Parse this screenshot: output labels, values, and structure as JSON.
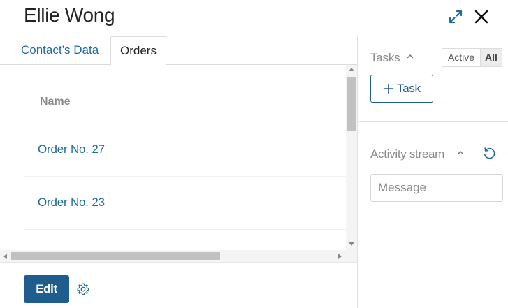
{
  "header": {
    "title": "Ellie Wong",
    "expand_icon": "expand-arrows-icon",
    "close_icon": "close-icon"
  },
  "tabs": [
    {
      "label": "Contact’s Data",
      "active": false
    },
    {
      "label": "Orders",
      "active": true
    }
  ],
  "orders_table": {
    "columns": [
      "Name"
    ],
    "rows": [
      {
        "name": "Order No. 27"
      },
      {
        "name": "Order No. 23"
      }
    ]
  },
  "footer": {
    "edit_label": "Edit",
    "settings_icon": "gear-icon"
  },
  "tasks": {
    "label": "Tasks",
    "filter_options": [
      "Active",
      "All"
    ],
    "selected_filter": "All",
    "add_task_label": "Task"
  },
  "activity": {
    "label": "Activity stream",
    "message_placeholder": "Message",
    "message_value": ""
  },
  "colors": {
    "accent": "#1f5d8e",
    "link": "#1f6a9e",
    "muted_text": "#8a8a8a"
  }
}
